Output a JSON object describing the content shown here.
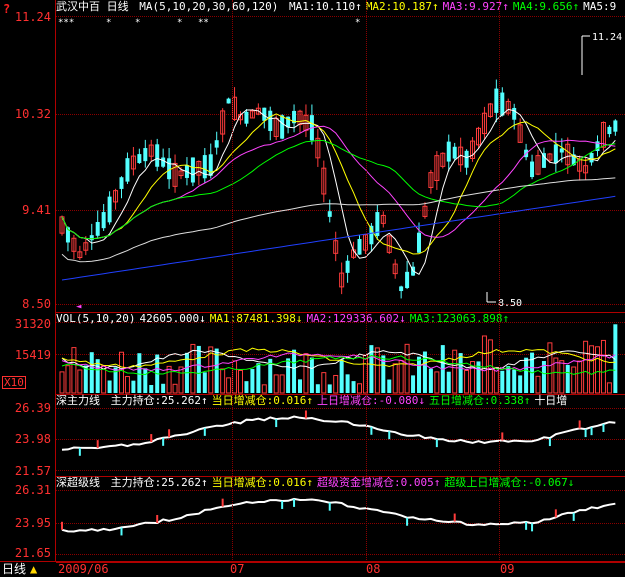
{
  "app": {
    "question_mark": "?",
    "multiplier": "X10"
  },
  "kline": {
    "title": "武汉中百 日线",
    "ma_params": "MA(5,10,20,30,60,120)",
    "ma": [
      {
        "label": "MA1:",
        "value": "10.110",
        "arrow": "↑",
        "color": "#ffffff"
      },
      {
        "label": "MA2:",
        "value": "10.187",
        "arrow": "↑",
        "color": "#ffff00"
      },
      {
        "label": "MA3:",
        "value": "9.927",
        "arrow": "↑",
        "color": "#ff44ff"
      },
      {
        "label": "MA4:",
        "value": "9.656",
        "arrow": "↑",
        "color": "#00ff00"
      },
      {
        "label": "MA5:",
        "value": "9",
        "arrow": "",
        "color": "#ffffff"
      }
    ],
    "y_labels": [
      "11.24",
      "10.32",
      "9.41",
      "8.50"
    ],
    "high_marker": "11.24",
    "low_marker": "8.50",
    "stars": [
      "***",
      "*",
      "*",
      "*",
      "**",
      "*"
    ]
  },
  "volume": {
    "legend": [
      {
        "label": "VOL(5,10,20)",
        "value": "",
        "arrow": "",
        "color": "#ffffff"
      },
      {
        "label": "",
        "value": "42605.000",
        "arrow": "↓",
        "color": "#ffffff"
      },
      {
        "label": "MA1:",
        "value": "87481.398",
        "arrow": "↓",
        "color": "#ffff00"
      },
      {
        "label": "MA2:",
        "value": "129336.602",
        "arrow": "↓",
        "color": "#ff44ff"
      },
      {
        "label": "MA3:",
        "value": "123063.898",
        "arrow": "↑",
        "color": "#00ff00"
      }
    ],
    "y_labels": [
      "31320",
      "15419"
    ]
  },
  "indicator1": {
    "title": "深主力线",
    "legend": [
      {
        "label": "主力持仓:",
        "value": "25.262",
        "arrow": "↑",
        "color": "#ffffff"
      },
      {
        "label": "当日增减仓:",
        "value": "0.016",
        "arrow": "↑",
        "color": "#ffff00"
      },
      {
        "label": "上日增减仓:",
        "value": "-0.080",
        "arrow": "↓",
        "color": "#ff44ff"
      },
      {
        "label": "五日增减仓:",
        "value": "0.338",
        "arrow": "↑",
        "color": "#00ff00"
      },
      {
        "label": "十日增",
        "value": "",
        "arrow": "",
        "color": "#ffffff"
      }
    ],
    "y_labels": [
      "26.39",
      "23.98",
      "21.57"
    ]
  },
  "indicator2": {
    "title": "深超级线",
    "legend": [
      {
        "label": "主力持仓:",
        "value": "25.262",
        "arrow": "↑",
        "color": "#ffffff"
      },
      {
        "label": "当日增减仓:",
        "value": "0.016",
        "arrow": "↑",
        "color": "#ffff00"
      },
      {
        "label": "超级资金增减仓:",
        "value": "0.005",
        "arrow": "↑",
        "color": "#ff44ff"
      },
      {
        "label": "超级上日增减仓:",
        "value": "-0.067",
        "arrow": "↓",
        "color": "#00ff00"
      }
    ],
    "y_labels": [
      "26.31",
      "23.95",
      "21.65"
    ]
  },
  "footer": {
    "period_label": "日线",
    "dates": [
      "2009/06",
      "07",
      "08",
      "09"
    ]
  },
  "colors": {
    "up": "#ff3c3c",
    "down": "#54ffff",
    "grid": "#8a0000",
    "axis_text": "#ff3030"
  }
}
